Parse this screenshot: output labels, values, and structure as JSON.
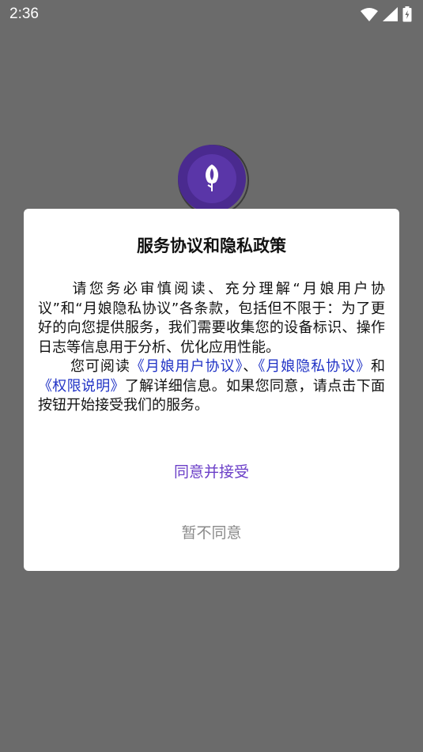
{
  "status_bar": {
    "time": "2:36",
    "icons": [
      "wifi-icon",
      "signal-icon",
      "battery-charging-icon"
    ]
  },
  "logo": {
    "icon": "rose-logo-icon",
    "colors": {
      "primary": "#4a2a8f"
    }
  },
  "dialog": {
    "title": "服务协议和隐私政策",
    "paragraph1": "请您务必审慎阅读、充分理解“月娘用户协议”和“月娘隐私协议”各条款，包括但不限于：为了更好的向您提供服务，我们需要收集您的设备标识、操作日志等信息用于分析、优化应用性能。",
    "p2_text1": "您可阅读",
    "link_user_agreement": "《月娘用户协议》",
    "p2_sep1": "、",
    "link_privacy_agreement": "《月娘隐私协议》",
    "p2_sep2": "和",
    "link_permissions": "《权限说明》",
    "p2_text2": "了解详细信息。如果您同意，请点击下面按钮开始接受我们的服务。",
    "accept_label": "同意并接受",
    "decline_label": "暂不同意"
  },
  "colors": {
    "overlay": "#6b6b6b",
    "link": "#2234c6",
    "accept": "#6b3fc8",
    "decline": "#8a8a8a"
  }
}
